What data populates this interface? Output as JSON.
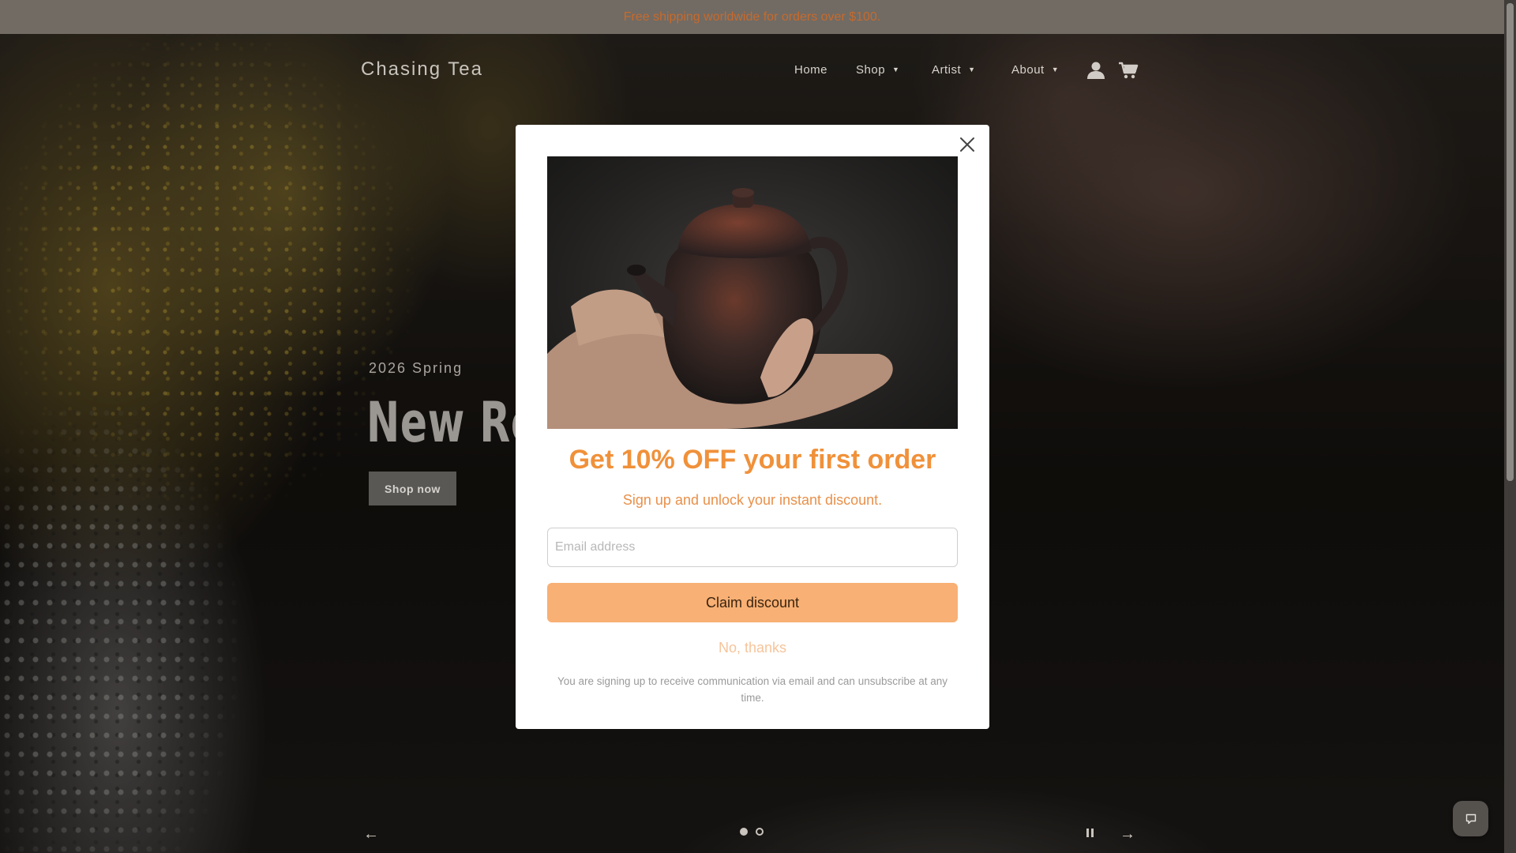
{
  "announcement": {
    "text": "Free shipping worldwide for orders over $100."
  },
  "header": {
    "logo": "Chasing Tea",
    "nav": [
      {
        "label": "Home",
        "has_dropdown": false
      },
      {
        "label": "Shop",
        "has_dropdown": true
      },
      {
        "label": "Artist",
        "has_dropdown": true
      },
      {
        "label": "About",
        "has_dropdown": true
      }
    ],
    "icons": [
      "account-icon",
      "cart-icon"
    ]
  },
  "hero": {
    "eyebrow": "2026 Spring",
    "headline": "New Rel",
    "cta": "Shop now",
    "slides": {
      "count": 2,
      "active": 1
    }
  },
  "popup": {
    "image": "teapot-in-hand",
    "title": "Get 10% OFF your first order",
    "subtitle": "Sign up and unlock your instant discount.",
    "email_placeholder": "Email address",
    "email_value": "",
    "submit_label": "Claim discount",
    "dismiss_label": "No, thanks",
    "legal": "You are signing up to receive communication via email and can unsubscribe at any time."
  },
  "colors": {
    "accent": "#f0913a",
    "button": "#f8b074",
    "announcement_bg": "#716b64",
    "announcement_text": "#c76a2c"
  }
}
